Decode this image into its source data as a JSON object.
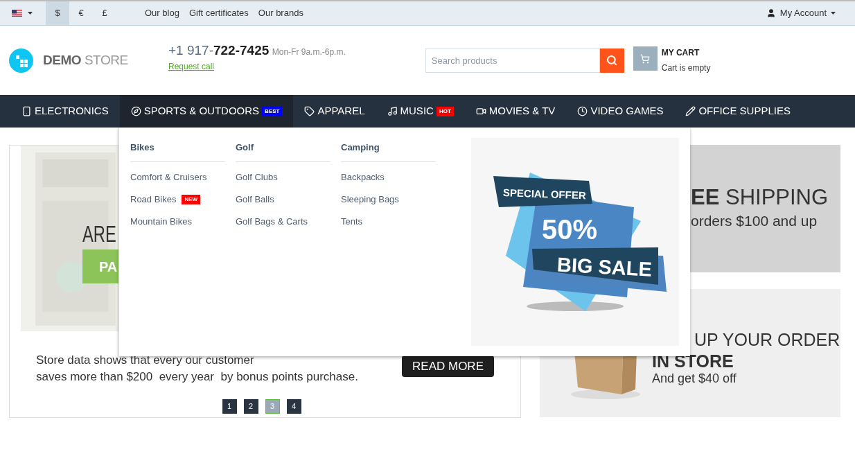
{
  "top_bar": {
    "language": {
      "kind": "flag"
    },
    "currencies": [
      {
        "label": "$",
        "selected": true
      },
      {
        "label": "€",
        "selected": false
      },
      {
        "label": "£",
        "selected": false
      }
    ],
    "links": [
      "Our blog",
      "Gift certificates",
      "Our brands"
    ],
    "account": "My Account"
  },
  "header": {
    "logo": {
      "bold": "DEMO",
      "light": "STORE"
    },
    "phone": {
      "prefix": "+1 917-",
      "number": "722-7425",
      "hours": "Mon-Fr 9a.m.-6p.m."
    },
    "request_call": "Request call",
    "search": {
      "placeholder": "Search products"
    },
    "cart": {
      "title": "MY CART",
      "status": "Cart is empty"
    }
  },
  "nav": [
    {
      "label": "ELECTRONICS",
      "selected": false
    },
    {
      "label": "SPORTS & OUTDOORS",
      "selected": true,
      "badge": {
        "text": "BEST",
        "color": "#0000ff"
      }
    },
    {
      "label": "APPAREL",
      "selected": false
    },
    {
      "label": "MUSIC",
      "selected": false,
      "badge": {
        "text": "HOT",
        "color": "#ff0000"
      }
    },
    {
      "label": "MOVIES & TV",
      "selected": false
    },
    {
      "label": "VIDEO GAMES",
      "selected": false
    },
    {
      "label": "OFFICE SUPPLIES",
      "selected": false
    }
  ],
  "mega_menu": {
    "columns": [
      {
        "title": "Bikes",
        "items": [
          {
            "label": "Comfort & Cruisers"
          },
          {
            "label": "Road Bikes",
            "badge": {
              "text": "NEW",
              "color": "#ff0000"
            }
          },
          {
            "label": "Mountain Bikes"
          }
        ]
      },
      {
        "title": "Golf",
        "items": [
          {
            "label": "Golf Clubs"
          },
          {
            "label": "Golf Balls"
          },
          {
            "label": "Golf Bags & Carts"
          }
        ]
      },
      {
        "title": "Camping",
        "items": [
          {
            "label": "Backpacks"
          },
          {
            "label": "Sleeping Bags"
          },
          {
            "label": "Tents"
          }
        ]
      }
    ],
    "promo": {
      "tag": "SPECIAL OFFER",
      "discount": "50%",
      "banner": "BIG SALE"
    }
  },
  "slider": {
    "heading": "ARE",
    "button": "PA",
    "caption": [
      "Store data shows that every our customer",
      "saves more than $200  every year  by bonus points purchase."
    ],
    "read_more": "READ MORE",
    "pages": [
      {
        "label": "1",
        "selected": false
      },
      {
        "label": "2",
        "selected": false
      },
      {
        "label": "3",
        "selected": true
      },
      {
        "label": "4",
        "selected": false
      }
    ]
  },
  "banners": [
    {
      "kind": "shipping",
      "title": "**EE** SHIPPING",
      "subtitle": "orders $100 and up"
    },
    {
      "kind": "pickup",
      "title": "UP YOUR ORDER",
      "highlight": "IN STORE",
      "subtitle": "And get $40 off"
    }
  ]
}
